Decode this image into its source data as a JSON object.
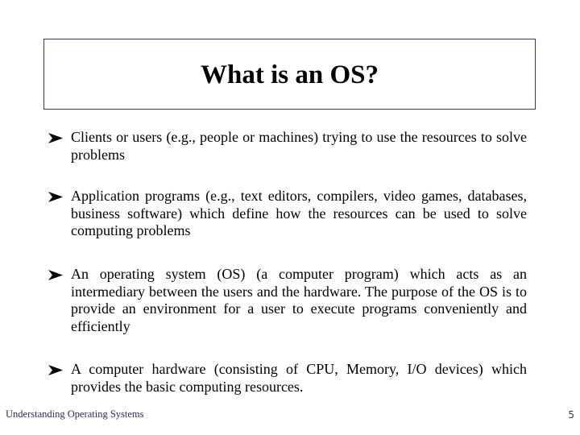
{
  "slide": {
    "title": "What is an OS?",
    "bullet_icon": "arrowhead-bullet-icon",
    "bullets": [
      {
        "text": "Clients or users (e.g., people or machines) trying to use the resources to solve problems"
      },
      {
        "text": "Application programs (e.g., text editors, compilers, video games, databases, business software) which define how the resources can be used to solve computing problems"
      },
      {
        "text": "An operating system (OS) (a computer program) which acts as an intermediary between the users and the hardware. The purpose of the OS is to provide an environment for a user to execute programs conveniently and efficiently"
      },
      {
        "text": "A computer hardware (consisting of CPU, Memory, I/O devices) which provides the basic computing resources."
      }
    ],
    "footer": {
      "left": "Understanding Operating Systems",
      "page_number": "5"
    },
    "colors": {
      "title_border": "#3b3860",
      "text": "#000000",
      "footer_text": "#2f2b5a"
    }
  }
}
